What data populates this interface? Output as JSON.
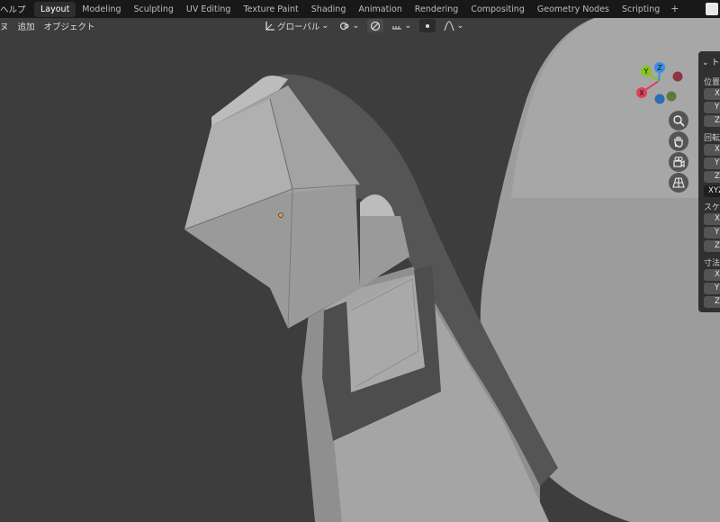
{
  "topbar": {
    "help_menu": "ヘルプ",
    "tabs": [
      "Layout",
      "Modeling",
      "Sculpting",
      "UV Editing",
      "Texture Paint",
      "Shading",
      "Animation",
      "Rendering",
      "Compositing",
      "Geometry Nodes",
      "Scripting"
    ],
    "active_tab": "Layout",
    "add_tab": "+"
  },
  "viewport_header": {
    "menu_view_fragment": "ヌ",
    "menu_add": "追加",
    "menu_object": "オブジェクト",
    "transform_orientation": "グローバル",
    "icons": [
      "transform-pivot-icon",
      "snap-icon",
      "proportional-edit-icon",
      "falloff-icon"
    ]
  },
  "gizmo": {
    "x_label": "X",
    "y_label": "Y",
    "z_label": "Z",
    "colors": {
      "x": "#e0405a",
      "y": "#83c61f",
      "z": "#3a8ee6"
    }
  },
  "nav_buttons": [
    "zoom-icon",
    "hand-pan-icon",
    "camera-icon",
    "perspective-grid-icon"
  ],
  "npanel": {
    "title_fragment": "ト",
    "location_label": "位置",
    "rotation_label": "回転",
    "rotation_mode": "XYZ",
    "scale_label": "スケ",
    "dimensions_label": "寸法",
    "axis_x": "X",
    "axis_y": "Y",
    "axis_z": "Z"
  }
}
